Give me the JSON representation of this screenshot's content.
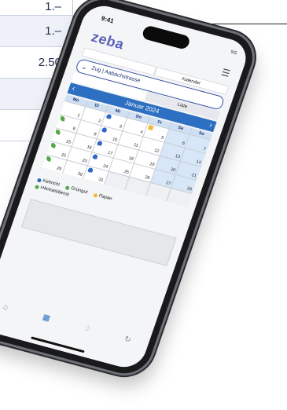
{
  "background_table": {
    "rows": [
      {
        "value": "1.–",
        "shaded": false
      },
      {
        "value": "1.–",
        "shaded": true
      },
      {
        "value": "2.50",
        "shaded": false
      },
      {
        "value": "",
        "shaded": true
      },
      {
        "value": "",
        "shaded": false
      }
    ]
  },
  "phone": {
    "status": {
      "time": "9:41",
      "right": "5G"
    },
    "app": {
      "logo": "zeba",
      "tabs": [
        "",
        "Kalender"
      ],
      "location": "Zug | Aabachstrasse",
      "view_tabs": [
        "",
        "Liste"
      ],
      "month": "Januar 2024",
      "weekdays": [
        "Mo",
        "Di",
        "Mi",
        "Do",
        "Fr",
        "Sa",
        "So"
      ],
      "days": [
        {
          "n": "1",
          "ico": "",
          "weekend": false
        },
        {
          "n": "2",
          "ico": "",
          "weekend": false
        },
        {
          "n": "3",
          "ico": "blue",
          "weekend": false
        },
        {
          "n": "4",
          "ico": "",
          "weekend": false
        },
        {
          "n": "5",
          "ico": "yellow",
          "weekend": false
        },
        {
          "n": "6",
          "ico": "",
          "weekend": true
        },
        {
          "n": "7",
          "ico": "",
          "weekend": true
        },
        {
          "n": "8",
          "ico": "green",
          "weekend": false
        },
        {
          "n": "9",
          "ico": "",
          "weekend": false
        },
        {
          "n": "10",
          "ico": "blue",
          "weekend": false
        },
        {
          "n": "11",
          "ico": "",
          "weekend": false
        },
        {
          "n": "12",
          "ico": "",
          "weekend": false
        },
        {
          "n": "13",
          "ico": "",
          "weekend": true
        },
        {
          "n": "14",
          "ico": "",
          "weekend": true
        },
        {
          "n": "15",
          "ico": "green",
          "weekend": false
        },
        {
          "n": "16",
          "ico": "",
          "weekend": false
        },
        {
          "n": "17",
          "ico": "blue",
          "weekend": false
        },
        {
          "n": "18",
          "ico": "",
          "weekend": false
        },
        {
          "n": "19",
          "ico": "",
          "weekend": false
        },
        {
          "n": "20",
          "ico": "",
          "weekend": true
        },
        {
          "n": "21",
          "ico": "",
          "weekend": true
        },
        {
          "n": "22",
          "ico": "green",
          "weekend": false
        },
        {
          "n": "23",
          "ico": "",
          "weekend": false
        },
        {
          "n": "24",
          "ico": "blue",
          "weekend": false
        },
        {
          "n": "25",
          "ico": "",
          "weekend": false
        },
        {
          "n": "26",
          "ico": "",
          "weekend": false
        },
        {
          "n": "27",
          "ico": "",
          "weekend": true
        },
        {
          "n": "28",
          "ico": "",
          "weekend": true
        },
        {
          "n": "29",
          "ico": "green",
          "weekend": false
        },
        {
          "n": "30",
          "ico": "",
          "weekend": false
        },
        {
          "n": "31",
          "ico": "blue",
          "weekend": false
        },
        {
          "n": "",
          "ico": "",
          "weekend": false
        },
        {
          "n": "",
          "ico": "",
          "weekend": false
        },
        {
          "n": "",
          "ico": "",
          "weekend": false
        },
        {
          "n": "",
          "ico": "",
          "weekend": false
        }
      ],
      "legend": [
        {
          "label": "Kehricht",
          "color": "#2f68c6"
        },
        {
          "label": "Grüngut",
          "color": "#57a84b"
        },
        {
          "label": "Papier",
          "color": "#f1b73a"
        },
        {
          "label": "Häckseldienst",
          "color": "#57a84b"
        }
      ],
      "nav_icons": [
        "home-icon",
        "calendar-icon",
        "bell-icon",
        "refresh-icon"
      ]
    }
  }
}
